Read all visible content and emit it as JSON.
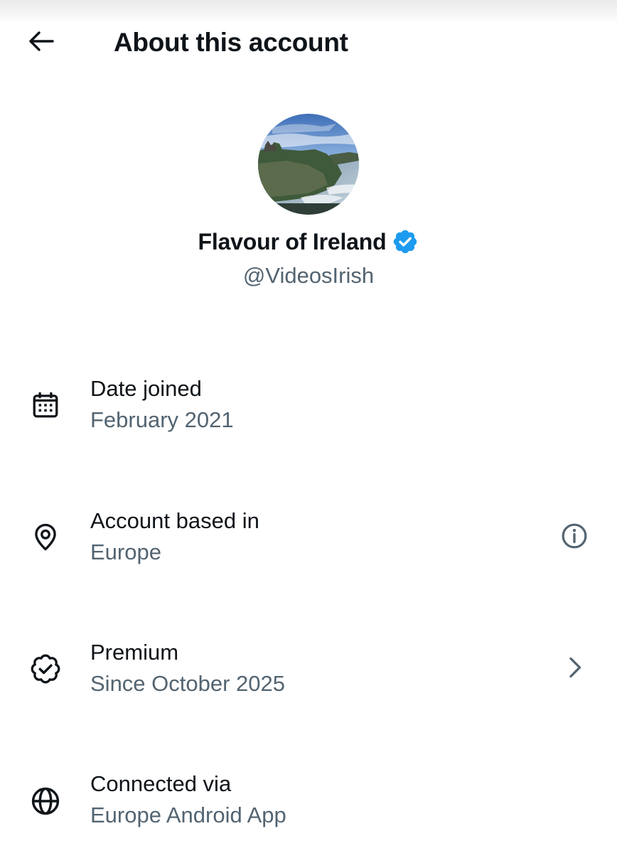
{
  "header": {
    "title": "About this account",
    "back_icon": "arrow-left-icon"
  },
  "profile": {
    "display_name": "Flavour of Ireland",
    "handle": "@VideosIrish",
    "verified": true,
    "verified_color": "#1d9bf0",
    "avatar_description_icon": "avatar-photo"
  },
  "rows": [
    {
      "label": "Date joined",
      "value": "February 2021",
      "icon": "calendar-icon"
    },
    {
      "label": "Account based in",
      "value": "Europe",
      "icon": "location-pin-icon",
      "action_icon": "info-icon"
    },
    {
      "label": "Premium",
      "value": "Since October 2025",
      "icon": "verified-badge-icon",
      "action_icon": "chevron-right-icon"
    },
    {
      "label": "Connected via",
      "value": "Europe Android App",
      "icon": "globe-icon"
    }
  ],
  "colors": {
    "primary_text": "#0f1419",
    "secondary_text": "#536471",
    "background": "#ffffff",
    "accent": "#1d9bf0"
  }
}
